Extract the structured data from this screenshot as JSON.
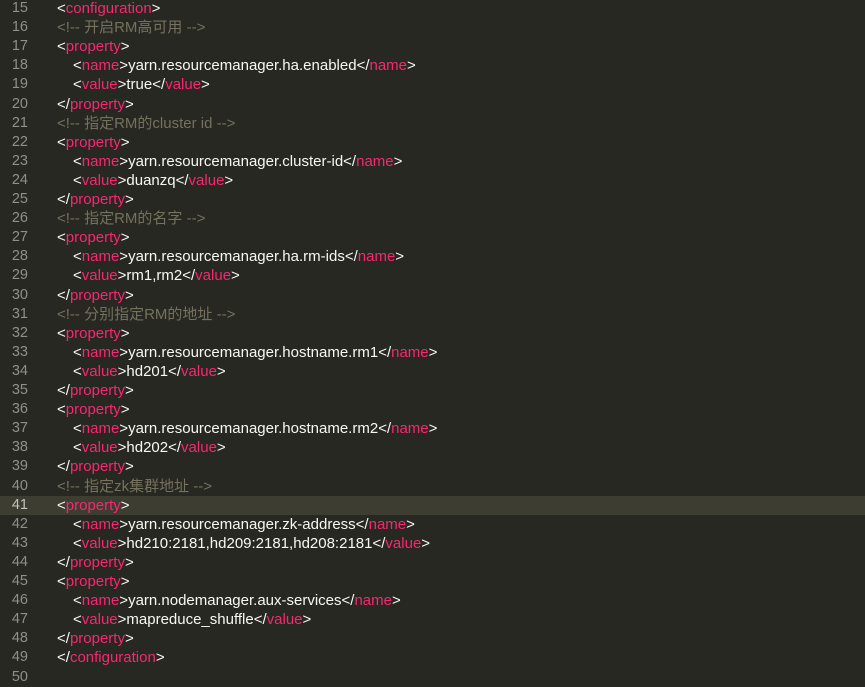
{
  "editor": {
    "colors": {
      "background": "#272822",
      "active_line": "#3e3d32",
      "gutter_text": "#90908a",
      "tag": "#f92672",
      "text": "#f8f8f2",
      "comment": "#75715e"
    },
    "active_line_number": "41",
    "lines": [
      {
        "num": "15",
        "indent": 0,
        "kind": "open",
        "tag": "configuration"
      },
      {
        "num": "16",
        "indent": 0,
        "kind": "comment",
        "text": "<!-- 开启RM高可用 -->"
      },
      {
        "num": "17",
        "indent": 0,
        "kind": "open",
        "tag": "property"
      },
      {
        "num": "18",
        "indent": 1,
        "kind": "element",
        "tag": "name",
        "value": "yarn.resourcemanager.ha.enabled"
      },
      {
        "num": "19",
        "indent": 1,
        "kind": "element",
        "tag": "value",
        "value": "true"
      },
      {
        "num": "20",
        "indent": 0,
        "kind": "close",
        "tag": "property"
      },
      {
        "num": "21",
        "indent": 0,
        "kind": "comment",
        "text": "<!-- 指定RM的cluster id -->"
      },
      {
        "num": "22",
        "indent": 0,
        "kind": "open",
        "tag": "property"
      },
      {
        "num": "23",
        "indent": 1,
        "kind": "element",
        "tag": "name",
        "value": "yarn.resourcemanager.cluster-id"
      },
      {
        "num": "24",
        "indent": 1,
        "kind": "element",
        "tag": "value",
        "value": "duanzq"
      },
      {
        "num": "25",
        "indent": 0,
        "kind": "close",
        "tag": "property"
      },
      {
        "num": "26",
        "indent": 0,
        "kind": "comment",
        "text": "<!-- 指定RM的名字 -->"
      },
      {
        "num": "27",
        "indent": 0,
        "kind": "open",
        "tag": "property"
      },
      {
        "num": "28",
        "indent": 1,
        "kind": "element",
        "tag": "name",
        "value": "yarn.resourcemanager.ha.rm-ids"
      },
      {
        "num": "29",
        "indent": 1,
        "kind": "element",
        "tag": "value",
        "value": "rm1,rm2"
      },
      {
        "num": "30",
        "indent": 0,
        "kind": "close",
        "tag": "property"
      },
      {
        "num": "31",
        "indent": 0,
        "kind": "comment",
        "text": "<!-- 分别指定RM的地址 -->"
      },
      {
        "num": "32",
        "indent": 0,
        "kind": "open",
        "tag": "property"
      },
      {
        "num": "33",
        "indent": 1,
        "kind": "element",
        "tag": "name",
        "value": "yarn.resourcemanager.hostname.rm1"
      },
      {
        "num": "34",
        "indent": 1,
        "kind": "element",
        "tag": "value",
        "value": "hd201"
      },
      {
        "num": "35",
        "indent": 0,
        "kind": "close",
        "tag": "property"
      },
      {
        "num": "36",
        "indent": 0,
        "kind": "open",
        "tag": "property"
      },
      {
        "num": "37",
        "indent": 1,
        "kind": "element",
        "tag": "name",
        "value": "yarn.resourcemanager.hostname.rm2"
      },
      {
        "num": "38",
        "indent": 1,
        "kind": "element",
        "tag": "value",
        "value": "hd202"
      },
      {
        "num": "39",
        "indent": 0,
        "kind": "close",
        "tag": "property"
      },
      {
        "num": "40",
        "indent": 0,
        "kind": "comment",
        "text": "<!-- 指定zk集群地址 -->"
      },
      {
        "num": "41",
        "indent": 0,
        "kind": "open",
        "tag": "property"
      },
      {
        "num": "42",
        "indent": 1,
        "kind": "element",
        "tag": "name",
        "value": "yarn.resourcemanager.zk-address"
      },
      {
        "num": "43",
        "indent": 1,
        "kind": "element",
        "tag": "value",
        "value": "hd210:2181,hd209:2181,hd208:2181"
      },
      {
        "num": "44",
        "indent": 0,
        "kind": "close",
        "tag": "property"
      },
      {
        "num": "45",
        "indent": 0,
        "kind": "open",
        "tag": "property"
      },
      {
        "num": "46",
        "indent": 1,
        "kind": "element",
        "tag": "name",
        "value": "yarn.nodemanager.aux-services"
      },
      {
        "num": "47",
        "indent": 1,
        "kind": "element",
        "tag": "value",
        "value": "mapreduce_shuffle"
      },
      {
        "num": "48",
        "indent": 0,
        "kind": "close",
        "tag": "property"
      },
      {
        "num": "49",
        "indent": 0,
        "kind": "close",
        "tag": "configuration"
      },
      {
        "num": "50",
        "indent": 0,
        "kind": "empty"
      }
    ]
  }
}
